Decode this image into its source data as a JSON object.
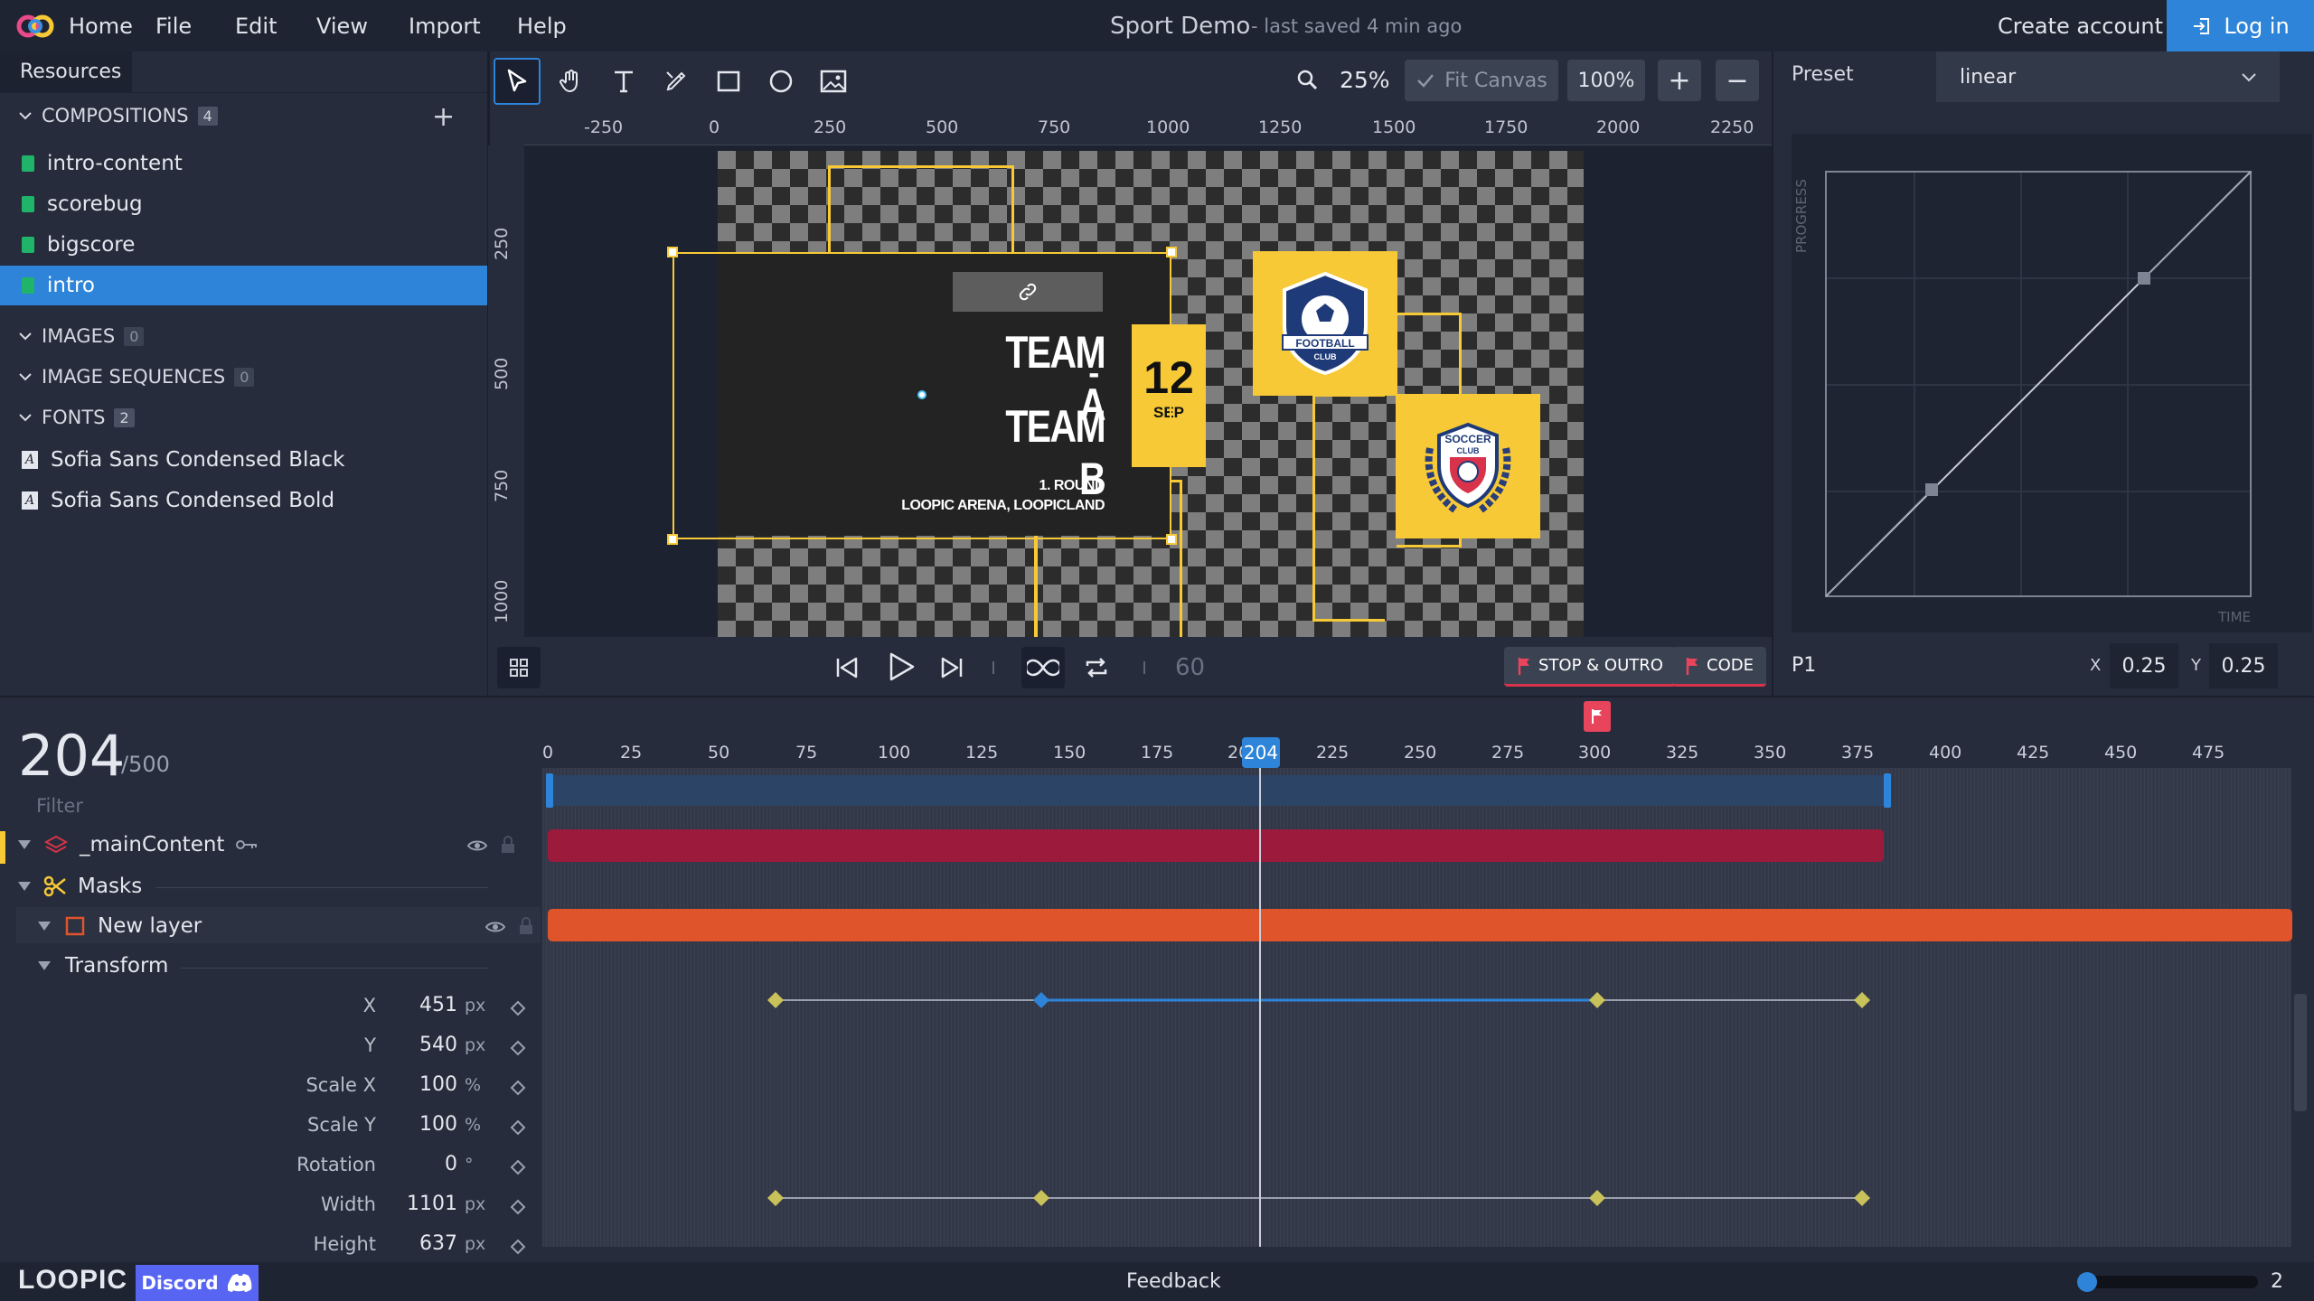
{
  "header": {
    "menu": [
      "Home",
      "File",
      "Edit",
      "View",
      "Import",
      "Help"
    ],
    "title": "Sport Demo",
    "saved": "- last saved 4 min ago",
    "create_account": "Create account",
    "login": "Log in"
  },
  "resources": {
    "tab": "Resources",
    "compositions": {
      "label": "COMPOSITIONS",
      "count": "4",
      "items": [
        "intro-content",
        "scorebug",
        "bigscore",
        "intro"
      ]
    },
    "images": {
      "label": "IMAGES",
      "count": "0"
    },
    "sequences": {
      "label": "IMAGE SEQUENCES",
      "count": "0"
    },
    "fonts": {
      "label": "FONTS",
      "count": "2",
      "items": [
        "Sofia Sans Condensed Black",
        "Sofia Sans Condensed Bold"
      ]
    }
  },
  "toolbar": {
    "zoom": "25%",
    "fit": "Fit Canvas",
    "full": "100%",
    "plus": "+",
    "minus": "−"
  },
  "ruler": {
    "h": [
      "-250",
      "0",
      "250",
      "500",
      "750",
      "1000",
      "1250",
      "1500",
      "1750",
      "2000",
      "2250"
    ],
    "v": [
      "250",
      "500",
      "750",
      "1000"
    ]
  },
  "canvas": {
    "team_a": "TEAM A",
    "dash": "-",
    "team_b": "TEAM B",
    "day": "12",
    "month": "SEP",
    "round": "1. ROUND",
    "arena": "LOOPIC ARENA, LOOPICLAND",
    "badge1": "FOOTBALL",
    "badge1b": "CLUB",
    "badge2": "SOCCER",
    "badge2b": "CLUB"
  },
  "playback": {
    "fps": "60",
    "stop_outro": "STOP & OUTRO",
    "code": "CODE"
  },
  "easing": {
    "preset_label": "Preset",
    "preset": "linear",
    "progress": "PROGRESS",
    "time": "TIME",
    "point": "P1",
    "x_label": "X",
    "x": "0.25",
    "y_label": "Y",
    "y": "0.25"
  },
  "timeline": {
    "current": "204",
    "total": "/500",
    "ticks": [
      "0",
      "25",
      "50",
      "75",
      "100",
      "125",
      "150",
      "175",
      "200",
      "225",
      "250",
      "275",
      "300",
      "325",
      "350",
      "375",
      "400",
      "425",
      "450",
      "475"
    ],
    "filter": "Filter",
    "layers": {
      "main": "_mainContent",
      "masks": "Masks",
      "new_layer": "New layer",
      "transform": "Transform"
    },
    "props": [
      {
        "label": "X",
        "value": "451",
        "unit": "px"
      },
      {
        "label": "Y",
        "value": "540",
        "unit": "px"
      },
      {
        "label": "Scale X",
        "value": "100",
        "unit": "%"
      },
      {
        "label": "Scale Y",
        "value": "100",
        "unit": "%"
      },
      {
        "label": "Rotation",
        "value": "0",
        "unit": "°"
      },
      {
        "label": "Width",
        "value": "1101",
        "unit": "px"
      },
      {
        "label": "Height",
        "value": "637",
        "unit": "px"
      }
    ]
  },
  "footer": {
    "brand": "LOOPIC",
    "discord": "Discord",
    "feedback": "Feedback",
    "zoom_level": "2"
  },
  "colors": {
    "accent": "#2d84d8",
    "yellow": "#f7c936",
    "layer_red": "#9c1a3b",
    "layer_orange": "#e0542c"
  }
}
